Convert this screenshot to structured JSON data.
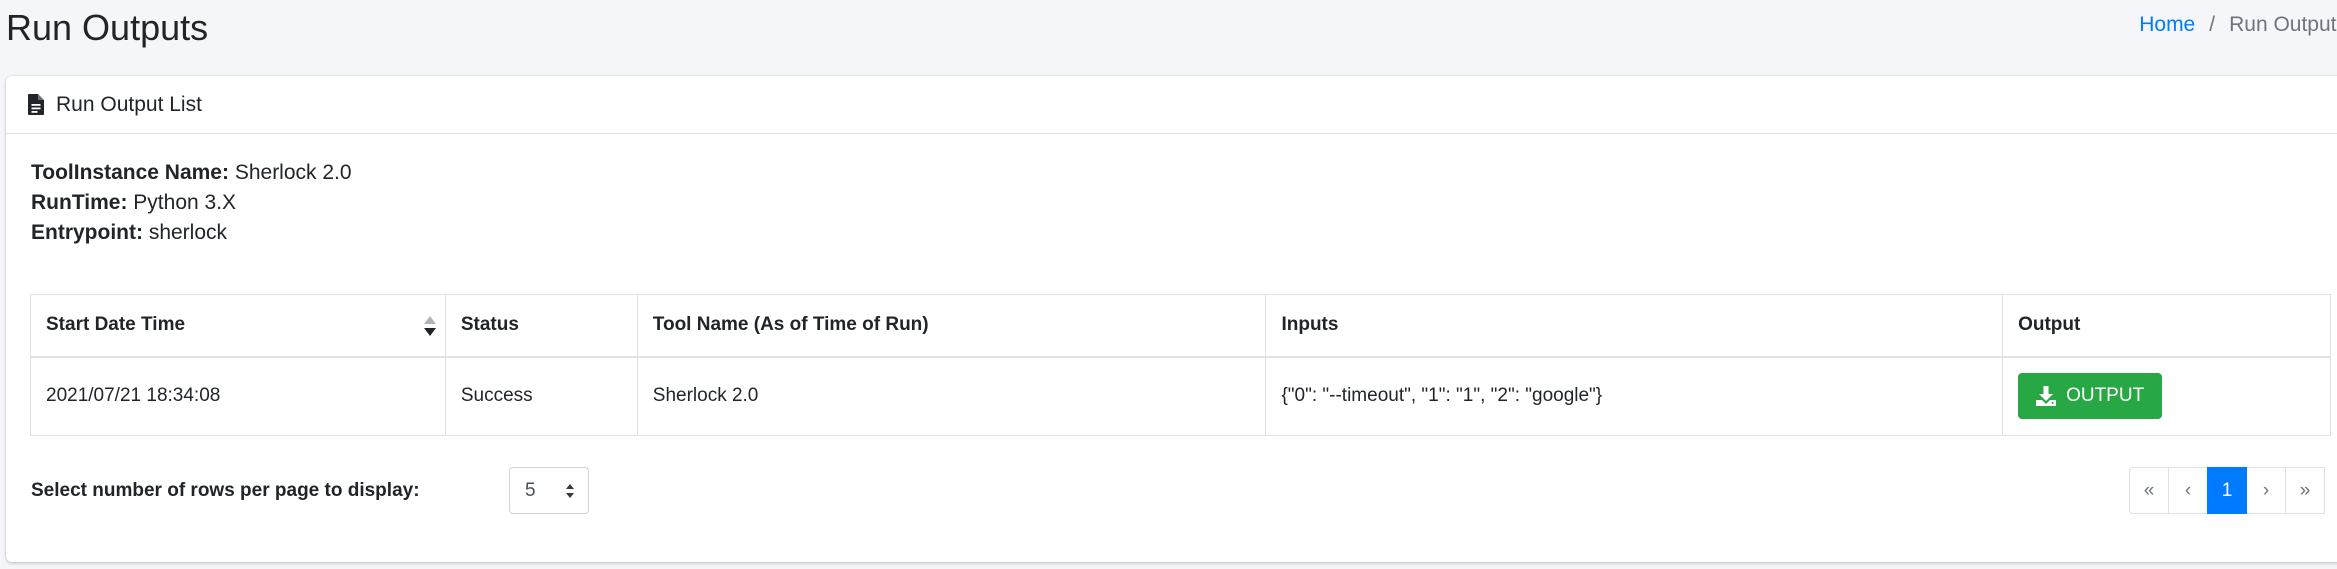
{
  "page": {
    "title": "Run Outputs"
  },
  "breadcrumb": {
    "home": "Home",
    "separator": "/",
    "current": "Run Outputs"
  },
  "card": {
    "header": "Run Output List",
    "icon": "file-icon"
  },
  "info": {
    "tool_instance_label": "ToolInstance Name:",
    "tool_instance_value": "Sherlock 2.0",
    "runtime_label": "RunTime:",
    "runtime_value": "Python 3.X",
    "entrypoint_label": "Entrypoint:",
    "entrypoint_value": "sherlock"
  },
  "table": {
    "columns": [
      "Start Date Time",
      "Status",
      "Tool Name (As of Time of Run)",
      "Inputs",
      "Output"
    ],
    "rows": [
      {
        "start": "2021/07/21 18:34:08",
        "status": "Success",
        "tool_name": "Sherlock 2.0",
        "inputs": "{\"0\": \"--timeout\", \"1\": \"1\", \"2\": \"google\"}",
        "output_button": "OUTPUT"
      }
    ]
  },
  "pager": {
    "rows_label": "Select number of rows per page to display:",
    "rows_value": "5",
    "first": "«",
    "prev": "‹",
    "current": "1",
    "next": "›",
    "last": "»"
  },
  "colors": {
    "primary": "#007bff",
    "success": "#28a745",
    "background": "#f4f6f9"
  }
}
